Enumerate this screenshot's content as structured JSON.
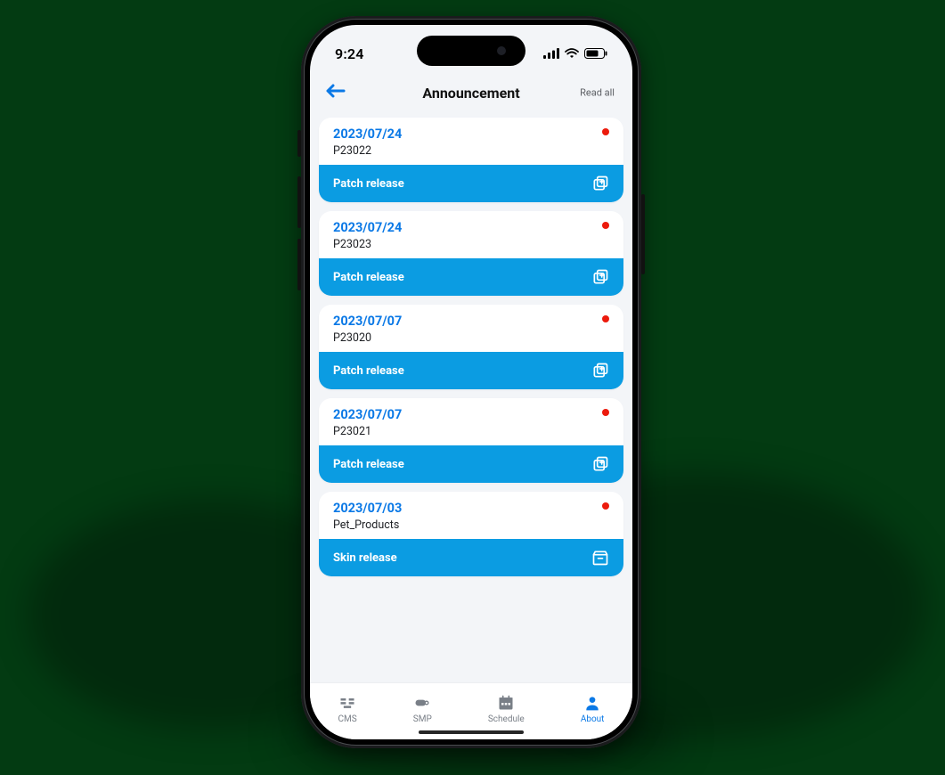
{
  "status": {
    "time": "9:24"
  },
  "header": {
    "title": "Announcement",
    "read_all": "Read all"
  },
  "announcements": [
    {
      "date": "2023/07/24",
      "code": "P23022",
      "label": "Patch release",
      "unread": true,
      "icon": "copy"
    },
    {
      "date": "2023/07/24",
      "code": "P23023",
      "label": "Patch release",
      "unread": true,
      "icon": "copy"
    },
    {
      "date": "2023/07/07",
      "code": "P23020",
      "label": "Patch release",
      "unread": true,
      "icon": "copy"
    },
    {
      "date": "2023/07/07",
      "code": "P23021",
      "label": "Patch release",
      "unread": true,
      "icon": "copy"
    },
    {
      "date": "2023/07/03",
      "code": "Pet_Products",
      "label": "Skin release",
      "unread": true,
      "icon": "box"
    }
  ],
  "tabs": {
    "cms": "CMS",
    "smp": "SMP",
    "schedule": "Schedule",
    "about": "About",
    "active": "about"
  }
}
